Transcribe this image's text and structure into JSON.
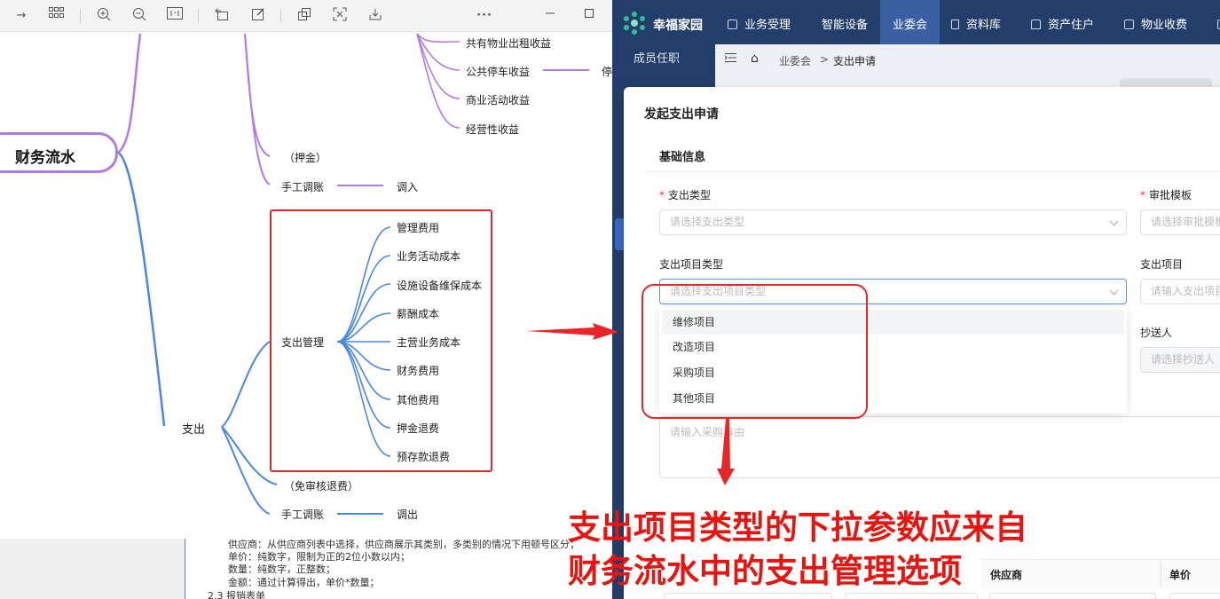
{
  "mindmap": {
    "root": "财务流水",
    "income_children": [
      "共有物业出租收益",
      "公共停车收益",
      "商业活动收益",
      "经营性收益"
    ],
    "parking_sub_partial": "停",
    "deposit_label": "（押金）",
    "income_manual": "手工调账",
    "income_manual_child": "调入",
    "expense": "支出",
    "expense_management": "支出管理",
    "expense_items": [
      "管理费用",
      "业务活动成本",
      "设施设备维保成本",
      "薪酬成本",
      "主营业务成本",
      "财务费用",
      "其他费用",
      "押金退费",
      "预存款退费"
    ],
    "exempt_refund": "（免审核退费）",
    "expense_manual": "手工调账",
    "expense_manual_child": "调出"
  },
  "toolbar": {
    "icons": [
      "arrow-right-icon",
      "grid-icon",
      "zoom-in-icon",
      "zoom-out-icon",
      "fit-icon",
      "rotate-icon",
      "edit-icon",
      "share-icon",
      "expand-icon",
      "download-icon",
      "more-icon",
      "minimize-icon",
      "maximize-icon"
    ],
    "more": "···"
  },
  "doc": {
    "line1": "供应商：从供应商列表中选择，供应商展示其类别，多类别的情况下用顿号区分；",
    "line2": "单价：纯数字，限制为正的2位小数以内；",
    "line3": "数量：纯数字，正整数；",
    "line4": "金额：通过计算得出，单价*数量；",
    "line5": "2.3 报销表单"
  },
  "app": {
    "brand": "幸福家园",
    "nav": [
      {
        "label": "业务受理",
        "icon": "camera-icon"
      },
      {
        "label": "智能设备",
        "icon": ""
      },
      {
        "label": "业委会",
        "icon": ""
      },
      {
        "label": "资料库",
        "icon": "file-icon"
      },
      {
        "label": "资产住户",
        "icon": "home-icon"
      },
      {
        "label": "物业收费",
        "icon": "receipt-icon"
      }
    ],
    "sidebar_item": "成员任职",
    "breadcrumb": {
      "home": "⌂",
      "level1": "业委会",
      "sep": ">",
      "level2": "支出申请"
    }
  },
  "modal": {
    "title": "发起支出申请",
    "section": "基础信息",
    "expense_type_label": "支出类型",
    "expense_type_placeholder": "请选择支出类型",
    "template_label": "审批模板",
    "template_placeholder": "请选择审批模板",
    "item_type_label": "支出项目类型",
    "item_type_placeholder": "请选择支出项目类型",
    "item_label": "支出项目",
    "item_placeholder": "请输入支出项目",
    "cc_label": "抄送人",
    "cc_placeholder": "请选择抄送人",
    "required_mark": "*",
    "dropdown_options": [
      "维修项目",
      "改造项目",
      "采购项目",
      "其他项目"
    ],
    "reason_placeholder": "请输入采购事由",
    "table_headers": {
      "supplier": "供应商",
      "price": "单价"
    }
  },
  "annotation": {
    "line1": "支出项目类型的下拉参数应来自",
    "line2": "财务流水中的支出管理选项"
  },
  "colors": {
    "income_branch": "#b07ae8",
    "expense_branch": "#4a86e8",
    "annotation_red": "#e8140f",
    "nav_bg": "#243e6b",
    "nav_active": "#3b5fa3"
  }
}
